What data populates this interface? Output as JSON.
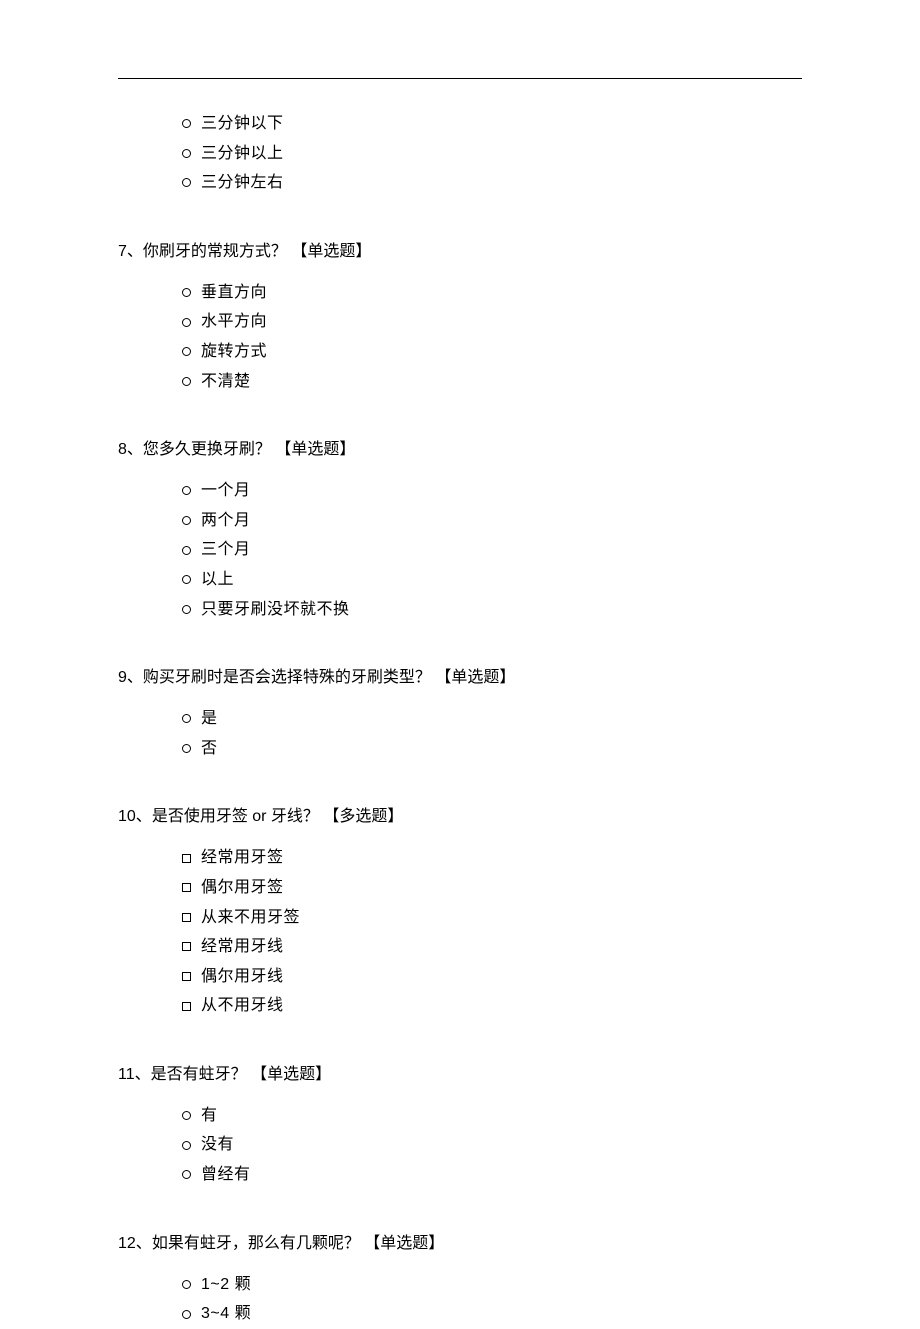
{
  "orphan_options": {
    "kind": "radio",
    "items": [
      "三分钟以下",
      "三分钟以上",
      "三分钟左右"
    ]
  },
  "questions": [
    {
      "num": "7、",
      "text": "你刷牙的常规方式？",
      "type": "【单选题】",
      "kind": "radio",
      "options": [
        "垂直方向",
        "水平方向",
        "旋转方式",
        "不清楚"
      ]
    },
    {
      "num": "8、",
      "text": "您多久更换牙刷？",
      "type": "【单选题】",
      "kind": "radio",
      "options": [
        "一个月",
        "两个月",
        "三个月",
        "以上",
        "只要牙刷没坏就不换"
      ]
    },
    {
      "num": "9、",
      "text": "购买牙刷时是否会选择特殊的牙刷类型？",
      "type": "【单选题】",
      "kind": "radio",
      "options": [
        "是",
        "否"
      ]
    },
    {
      "num": "10、",
      "text": "是否使用牙签 or 牙线？",
      "type": "【多选题】",
      "kind": "checkbox",
      "options": [
        "经常用牙签",
        "偶尔用牙签",
        "从来不用牙签",
        "经常用牙线",
        "偶尔用牙线",
        "从不用牙线"
      ]
    },
    {
      "num": "11、",
      "text": "是否有蛀牙？",
      "type": "【单选题】",
      "kind": "radio",
      "options": [
        "有",
        "没有",
        "曾经有"
      ]
    },
    {
      "num": "12、",
      "text": "如果有蛀牙，那么有几颗呢？",
      "type": "【单选题】",
      "kind": "radio",
      "options": [
        "1~2 颗",
        "3~4 颗"
      ]
    }
  ]
}
